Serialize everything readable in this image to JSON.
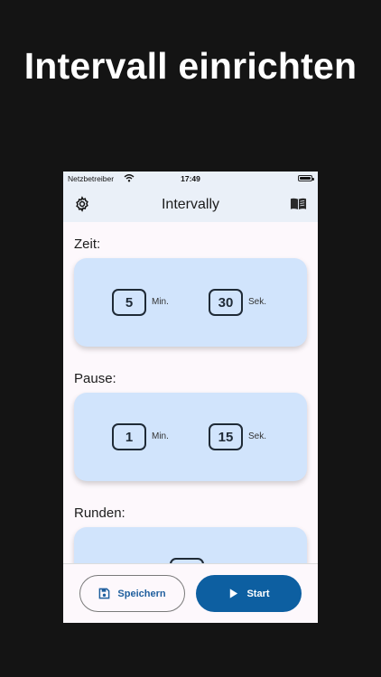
{
  "headline": "Intervall einrichten",
  "status_bar": {
    "carrier": "Netzbetreiber",
    "time": "17:49"
  },
  "app_bar": {
    "title": "Intervally"
  },
  "sections": {
    "zeit": {
      "label": "Zeit:",
      "minutes": "5",
      "minutes_unit": "Min.",
      "seconds": "30",
      "seconds_unit": "Sek."
    },
    "pause": {
      "label": "Pause:",
      "minutes": "1",
      "minutes_unit": "Min.",
      "seconds": "15",
      "seconds_unit": "Sek."
    },
    "runden": {
      "label": "Runden:"
    }
  },
  "actions": {
    "save_label": "Speichern",
    "start_label": "Start"
  },
  "colors": {
    "background": "#141414",
    "card": "#d1e4fc",
    "primary": "#0d5fa1",
    "appbar": "#eaf0f8"
  },
  "icons": [
    "wifi-icon",
    "battery-icon",
    "gear-icon",
    "book-icon",
    "save-icon",
    "play-icon"
  ]
}
